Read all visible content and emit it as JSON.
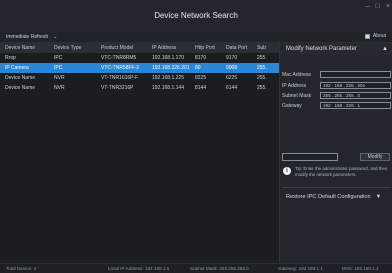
{
  "window": {
    "title": "Device Network Search",
    "controls": [
      "–",
      "□",
      "×"
    ]
  },
  "toolbar": {
    "refresh_label": "Immediate Refresh",
    "refresh_arrow": "⌄",
    "about_label": "About"
  },
  "table": {
    "headers": [
      "Device Name",
      "Device Type",
      "Product Model",
      "IP Address",
      "Http Port",
      "Data Port",
      "Sub"
    ],
    "rows": [
      [
        "Rrop",
        "IPC",
        "VTC-TNR8RM5",
        "192.168.1.170",
        "8170",
        "9170",
        "255."
      ],
      [
        "IP Camera",
        "IPC",
        "VTC-TNR58FF-2",
        "192.168.226.201",
        "80",
        "9008",
        "255."
      ],
      [
        "Device Name",
        "NVR",
        "VT-TNR1616P-F",
        "192.168.1.225",
        "8225",
        "6225",
        "255."
      ],
      [
        "Device Name",
        "NVR",
        "VT-TNR3216P",
        "192.168.1.144",
        "8144",
        "6144",
        "255."
      ]
    ]
  },
  "panel": {
    "title": "Modify Network Parameter",
    "collapse_icon": "▲",
    "mac_label": "Mac Address",
    "mac_value": "",
    "ip_label": "IP Address",
    "ip_value": "192 . 168 . 226 . 201",
    "mask_label": "Subnet Mask",
    "mask_value": "255 . 255 . 255 . 0",
    "gateway_label": "Gateway",
    "gateway_value": "192 . 168 . 226 . 1",
    "modify_label": "Modify",
    "tip_text": "Tip: Enter the administrator password, and then modify the network parameters.",
    "restore_label": "Restore IPC Default Configuration",
    "restore_arrow": "▼"
  },
  "status": {
    "total": "Total Device: 4",
    "local_ip": "Local IP Address: 192.168.1.6",
    "mask": "Subnet Mask: 255.255.255.0",
    "gateway": "Gateway: 192.168.1.1",
    "dns": "DNS: 192.168.1.1"
  }
}
